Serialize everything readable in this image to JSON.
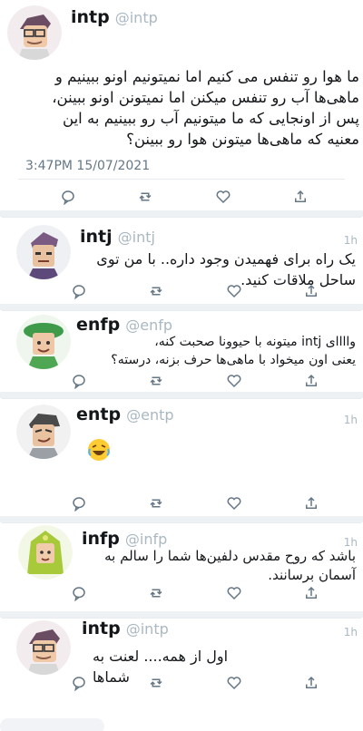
{
  "main_tweet": {
    "name": "intp",
    "handle": "@intp",
    "lines": [
      "ما هوا رو تنفس می کنیم اما نمیتونیم اونو ببینیم و",
      "ماهی‌ها آب رو تنفس میکنن اما نمیتونن اونو ببینن،",
      "پس از اونجایی که ما میتونیم آب رو ببینیم به این",
      "معنیه که ماهی‌ها میتونن هوا رو ببینن؟"
    ],
    "timestamp": "3:47PM 15/07/2021"
  },
  "replies": [
    {
      "name": "intj",
      "handle": "@intj",
      "time": "1h",
      "lines": [
        "یک راه برای فهمیدن وجود داره.. با من توی",
        "ساحل ملاقات کنید."
      ]
    },
    {
      "name": "enfp",
      "handle": "@enfp",
      "time": "",
      "lines": [
        "واااای intj میتونه با حیوونا صحبت کنه،",
        "یعنی اون میخواد با ماهی‌ها حرف بزنه، درسته؟"
      ]
    },
    {
      "name": "entp",
      "handle": "@entp",
      "time": "1h",
      "lines": []
    },
    {
      "name": "infp",
      "handle": "@infp",
      "time": "1h",
      "lines": [
        "باشد که روح مقدس دلفین‌ها شما را سالم به",
        "آسمان برسانند."
      ]
    },
    {
      "name": "intp",
      "handle": "@intp",
      "time": "1h",
      "lines": [
        "اول از همه.... لعنت به شماها"
      ]
    }
  ],
  "icons": {
    "reply": "reply-icon",
    "retweet": "retweet-icon",
    "like": "heart-icon",
    "share": "share-icon",
    "emoji": "laughing-emoji-icon"
  },
  "colors": {
    "text": "#14171a",
    "muted": "#aab8c2",
    "icon": "#657786"
  }
}
